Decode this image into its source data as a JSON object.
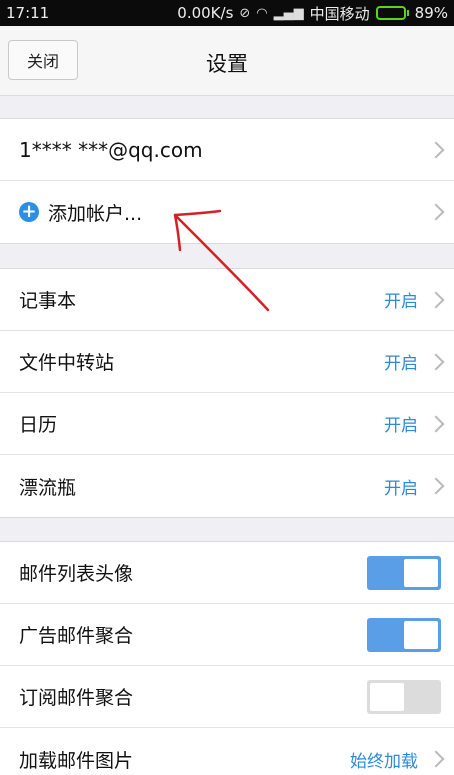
{
  "status_bar": {
    "time": "17:11",
    "speed": "0.00K/s",
    "carrier": "中国移动",
    "battery_percent": "89%",
    "battery_level": 0.89
  },
  "nav": {
    "close_label": "关闭",
    "title": "设置"
  },
  "accounts": {
    "email": "1**** ***@qq.com",
    "add_account_label": "添加帐户..."
  },
  "features": [
    {
      "label": "记事本",
      "value": "开启"
    },
    {
      "label": "文件中转站",
      "value": "开启"
    },
    {
      "label": "日历",
      "value": "开启"
    },
    {
      "label": "漂流瓶",
      "value": "开启"
    }
  ],
  "options": [
    {
      "label": "邮件列表头像",
      "toggle": "on"
    },
    {
      "label": "广告邮件聚合",
      "toggle": "on"
    },
    {
      "label": "订阅邮件聚合",
      "toggle": "off"
    }
  ],
  "load_images": {
    "label": "加载邮件图片",
    "value": "始终加载"
  },
  "colors": {
    "accent": "#2c8ad8",
    "toggle_on": "#5b9ee8",
    "annotation": "#d42027"
  }
}
